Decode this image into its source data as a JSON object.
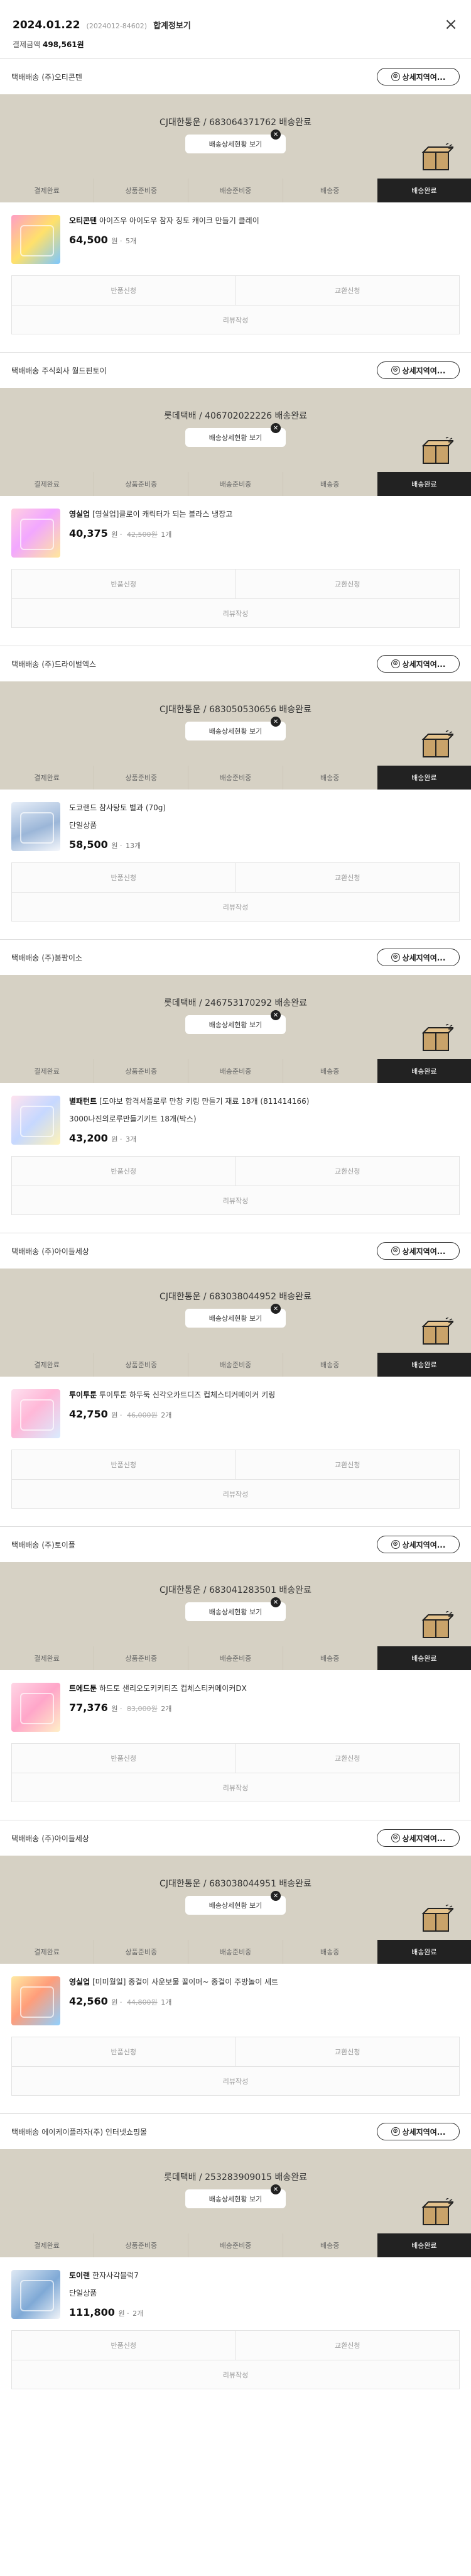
{
  "header": {
    "date": "2024.01.22",
    "order_no": "(2024012-84602)",
    "detail_link": "합계정보기",
    "total_label": "결제금액",
    "total_value": "498,561원",
    "close_icon": "×"
  },
  "common": {
    "ship_prefix": "택배배송",
    "track_button": "배송상세현황 보기",
    "detail_button": "상세지역여...",
    "return_label": "반품신청",
    "exchange_label": "교환신청",
    "review_label": "리뷰작성",
    "steps": [
      "결제완료",
      "상품준비중",
      "배송준비중",
      "배송중",
      "배송완료"
    ],
    "qty_unit": "원 ·"
  },
  "shipments": [
    {
      "seller": "(주)오티콘텐",
      "tracking": "CJ대한통운 / 683064371762 배송완료",
      "product": {
        "brand": "오티콘텐",
        "name": "아이즈우 아이도우 참자 칭토 캐이크 만들기 클레이",
        "price": "64,500",
        "orig": "",
        "qty": "5개"
      }
    },
    {
      "seller": "주식회사 월드핀토이",
      "tracking": "롯데택배 / 406702022226 배송완료",
      "product": {
        "brand": "영실업",
        "name": "[영실업]클로이 캐릭터가 되는 블라스 냉장고",
        "price": "40,375",
        "orig": "42,500원",
        "qty": "1개"
      }
    },
    {
      "seller": "(주)드라이벌엑스",
      "tracking": "CJ대한통운 / 683050530656 배송완료",
      "product": {
        "brand": "",
        "name": "도쿄랜드 참사탕토 별과 (70g)",
        "sub": "단일상품",
        "price": "58,500",
        "orig": "",
        "qty": "13개"
      }
    },
    {
      "seller": "(주)붐팜이소",
      "tracking": "롯데택배 / 246753170292 배송완료",
      "product": {
        "brand": "별패턴트",
        "name": "[도야보 합격서플로루 만창 키링 만들기 재료 18개 (811414166)",
        "sub": "3000나진의로루만들기키트 18개(박스)",
        "price": "43,200",
        "orig": "",
        "qty": "3개"
      }
    },
    {
      "seller": "(주)아이들세상",
      "tracking": "CJ대한통운 / 683038044952 배송완료",
      "product": {
        "brand": "투이투툰",
        "name": "투이투툰 하두둑 신각오카트디즈 컵체스티커메이커 키링",
        "price": "42,750",
        "orig": "46,000원",
        "qty": "2개"
      }
    },
    {
      "seller": "(주)토이플",
      "tracking": "CJ대한통운 / 683041283501 배송완료",
      "product": {
        "brand": "트에드툰",
        "name": "하드토 샌리오도키키티즈 컵체스티커메이커DX",
        "price": "77,376",
        "orig": "83,000원",
        "qty": "2개"
      }
    },
    {
      "seller": "(주)아이들세상",
      "tracking": "CJ대한통운 / 683038044951 배송완료",
      "product": {
        "brand": "영실업",
        "name": "[미미월일] 종걸이 사운보물 꿀이머~ 종걸이 주방놀이 세트",
        "price": "42,560",
        "orig": "44,800원",
        "qty": "1개"
      }
    },
    {
      "seller": "에이케이플라자(주) 인터넷쇼핑몰",
      "tracking": "롯데택배 / 253283909015 배송완료",
      "product": {
        "brand": "토이랜",
        "name": "한자사각블럭7",
        "sub": "단일상품",
        "price": "111,800",
        "orig": "",
        "qty": "2개"
      }
    }
  ],
  "colors": {
    "banner": "#d6d1c4",
    "active_step": "#222222"
  }
}
